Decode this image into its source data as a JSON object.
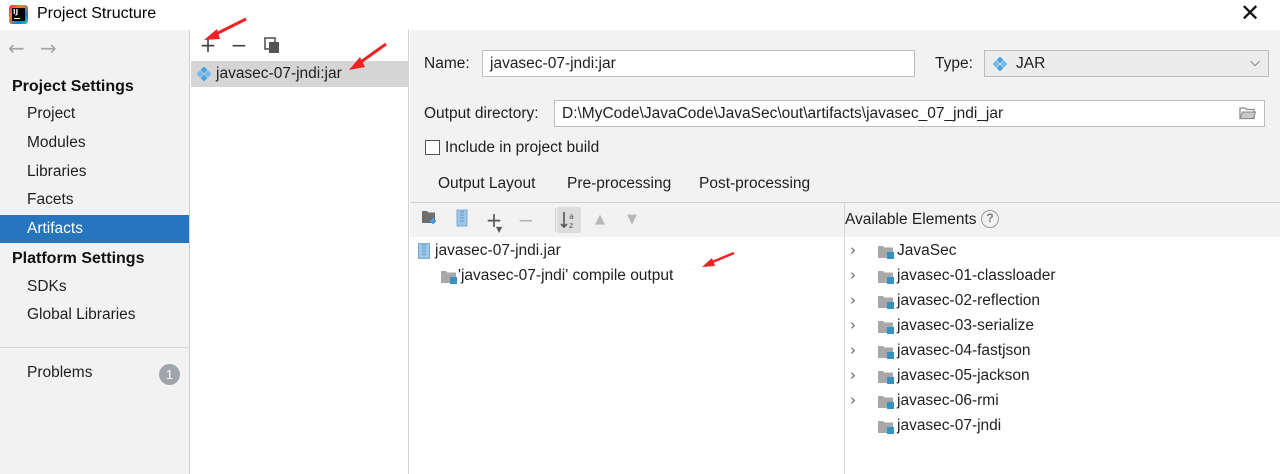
{
  "window": {
    "title": "Project Structure"
  },
  "sidebar": {
    "project_settings_title": "Project Settings",
    "project_items": [
      {
        "label": "Project"
      },
      {
        "label": "Modules"
      },
      {
        "label": "Libraries"
      },
      {
        "label": "Facets"
      },
      {
        "label": "Artifacts",
        "selected": true
      }
    ],
    "platform_settings_title": "Platform Settings",
    "platform_items": [
      {
        "label": "SDKs"
      },
      {
        "label": "Global Libraries"
      }
    ],
    "problems": {
      "label": "Problems",
      "count": "1"
    }
  },
  "artifacts_list": {
    "items": [
      {
        "label": "javasec-07-jndi:jar",
        "icon": "jar-artifact-icon",
        "selected": true
      }
    ]
  },
  "details": {
    "name_label": "Name:",
    "name_value": "javasec-07-jndi:jar",
    "type_label": "Type:",
    "type_value": "JAR",
    "output_dir_label": "Output directory:",
    "output_dir_value": "D:\\MyCode\\JavaCode\\JavaSec\\out\\artifacts\\javasec_07_jndi_jar",
    "include_in_build_label": "Include in project build",
    "include_in_build_checked": false,
    "tabs": [
      {
        "label": "Output Layout",
        "active": true
      },
      {
        "label": "Pre-processing"
      },
      {
        "label": "Post-processing"
      }
    ],
    "output_layout": {
      "root": "javasec-07-jndi.jar",
      "children": [
        "'javasec-07-jndi' compile output"
      ]
    },
    "available_elements": {
      "title": "Available Elements",
      "help": "?",
      "items": [
        {
          "label": "JavaSec",
          "expandable": true
        },
        {
          "label": "javasec-01-classloader",
          "expandable": true
        },
        {
          "label": "javasec-02-reflection",
          "expandable": true
        },
        {
          "label": "javasec-03-serialize",
          "expandable": true
        },
        {
          "label": "javasec-04-fastjson",
          "expandable": true
        },
        {
          "label": "javasec-05-jackson",
          "expandable": true
        },
        {
          "label": "javasec-06-rmi",
          "expandable": true
        },
        {
          "label": "javasec-07-jndi",
          "expandable": false
        }
      ]
    }
  },
  "colors": {
    "selection": "#2675bf",
    "annotation_arrow": "#ee2222",
    "jar_icon": "#4aa3e0"
  }
}
